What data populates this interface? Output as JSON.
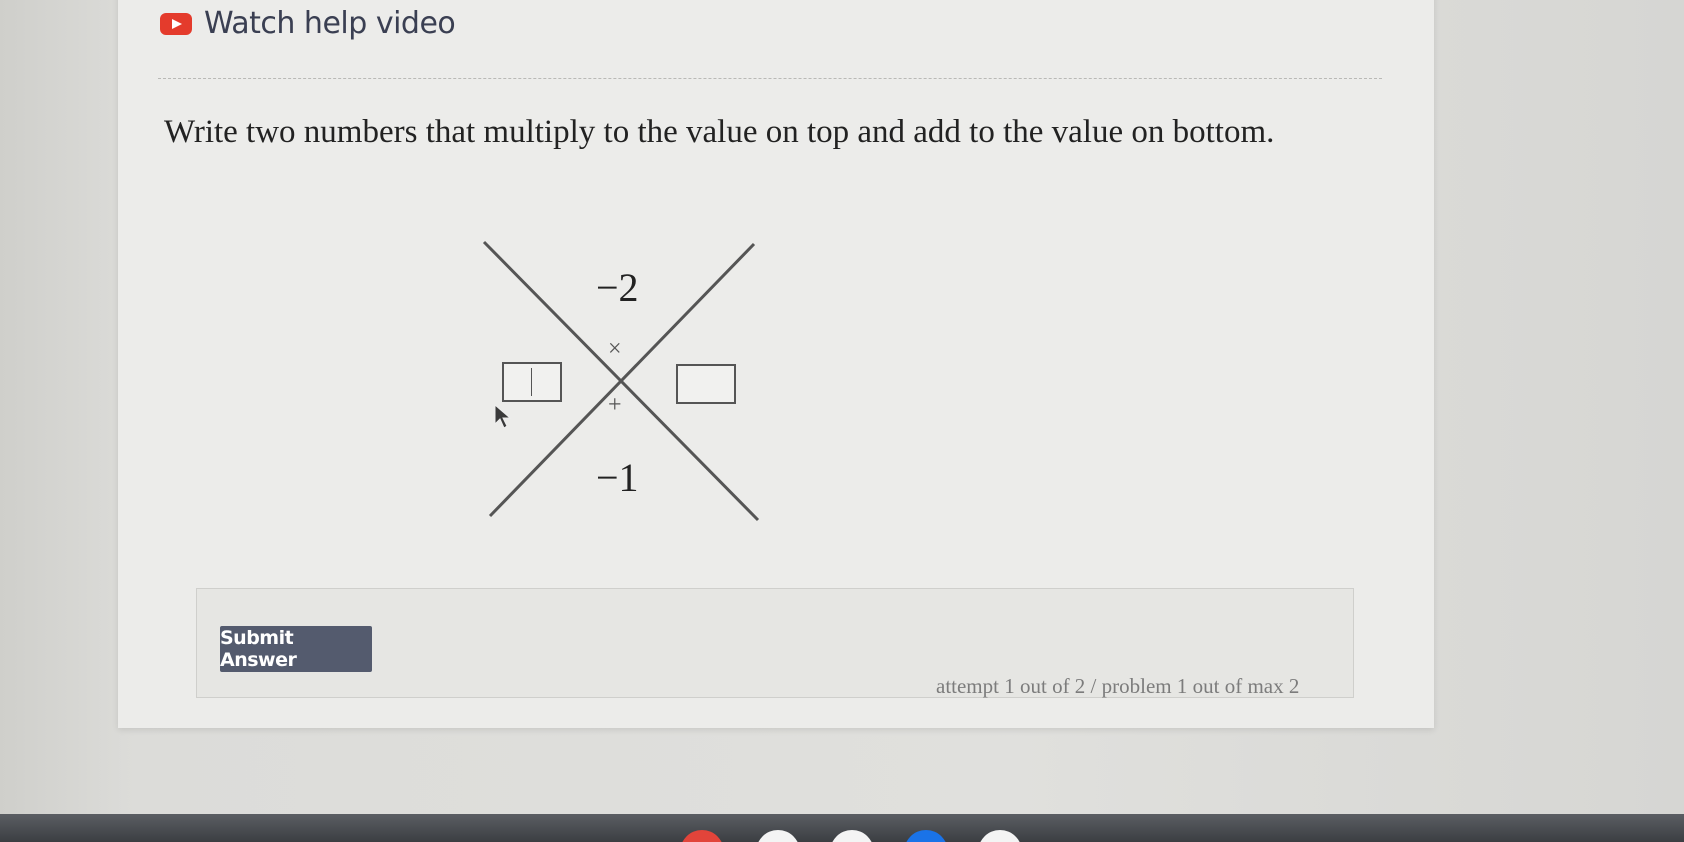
{
  "help": {
    "label": "Watch help video",
    "icon": "youtube-play-icon",
    "icon_color": "#e43b2c"
  },
  "question": {
    "text": "Write two numbers that multiply to the value on top and add to the value on bottom."
  },
  "diagram": {
    "top_value": "−2",
    "bottom_value": "−1",
    "times_symbol": "×",
    "plus_symbol": "+",
    "left_answer": "",
    "right_answer": ""
  },
  "submit": {
    "label": "Submit Answer",
    "color": "#545b6e"
  },
  "attempt": {
    "text": "attempt 1 out of 2 / problem 1 out of max 2"
  },
  "taskbar": {
    "icons": [
      "chrome-icon",
      "app-icon",
      "app-icon",
      "app-icon",
      "app-icon"
    ],
    "colors": [
      "#e2443a",
      "#ffffff",
      "#ffffff",
      "#1a73e8",
      "#ffffff"
    ]
  }
}
